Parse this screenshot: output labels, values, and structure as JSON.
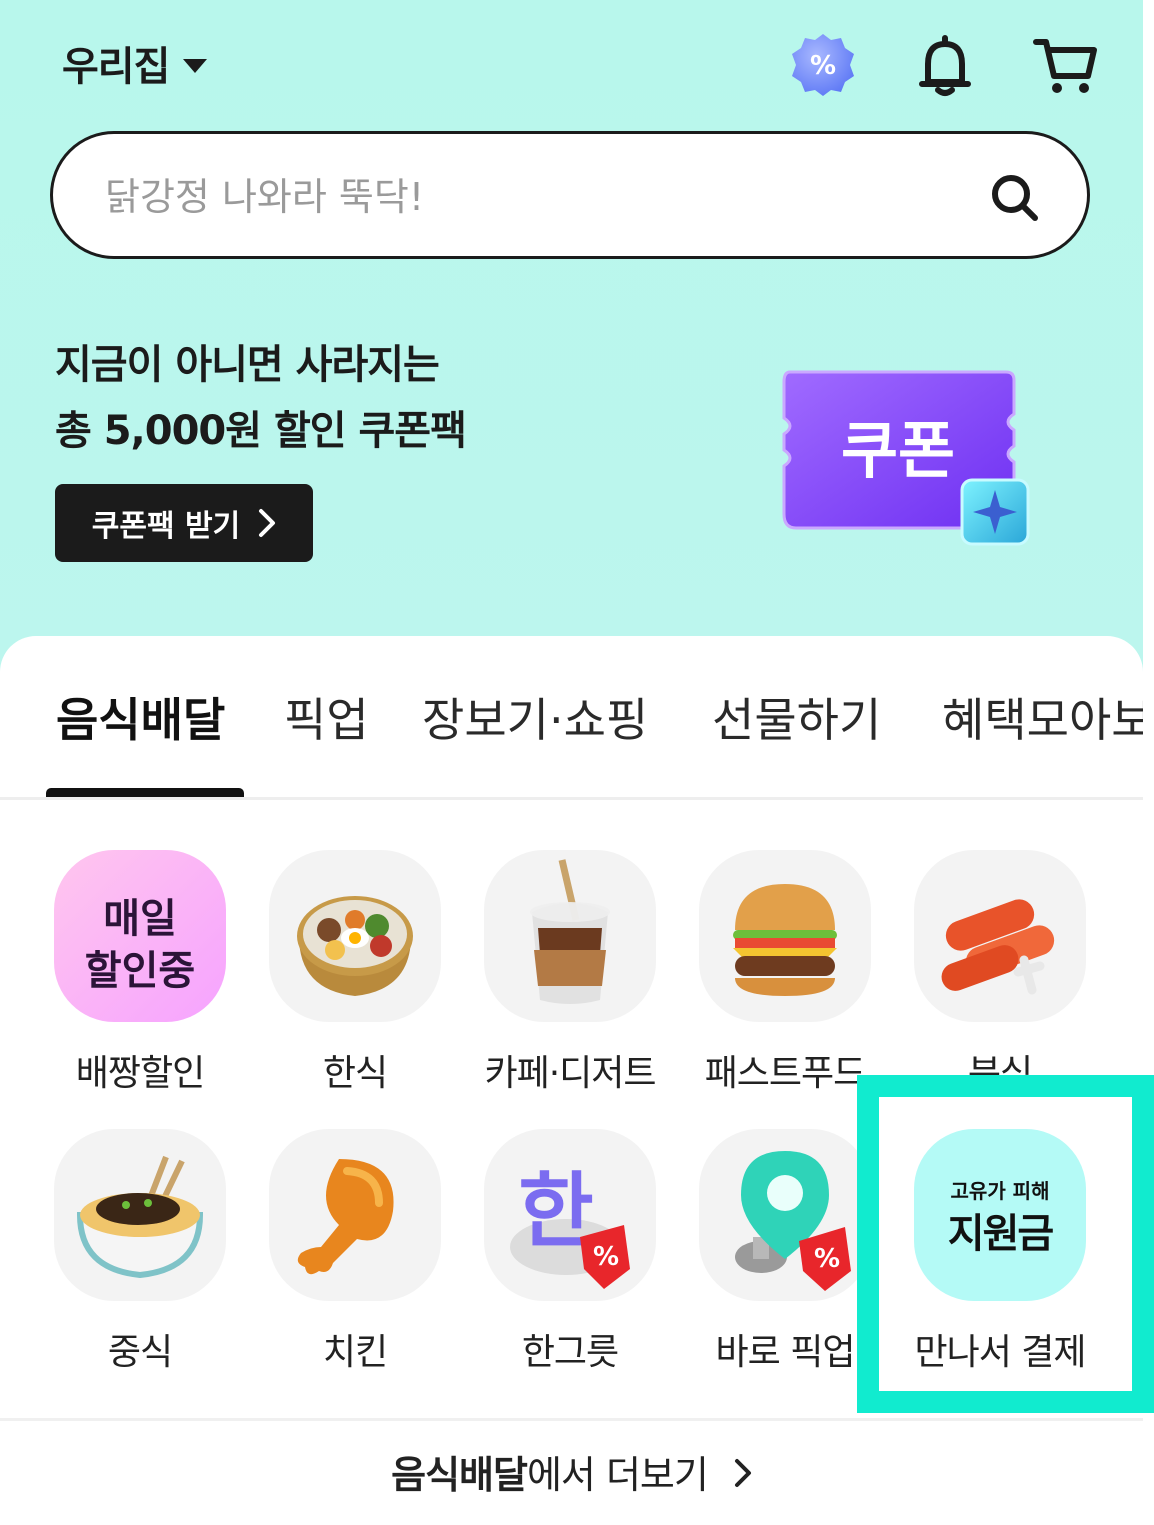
{
  "header": {
    "location": "우리집",
    "icons": [
      "discount-badge-icon",
      "bell-icon",
      "cart-icon"
    ],
    "discount_symbol": "%"
  },
  "search": {
    "placeholder": "닭강정 나와라 뚝닥!"
  },
  "promo": {
    "line1": "지금이 아니면 사라지는",
    "line2": "총 5,000원 할인 쿠폰팩",
    "button_label": "쿠폰팩 받기",
    "coupon_text": "쿠폰"
  },
  "tabs": [
    {
      "label": "음식배달",
      "active": true
    },
    {
      "label": "픽업"
    },
    {
      "label": "장보기·쇼핑"
    },
    {
      "label": "선물하기"
    },
    {
      "label": "혜택모아보기"
    }
  ],
  "categories": [
    {
      "label": "배짱할인",
      "icon": "daily-discount-icon",
      "tile_text": [
        "매일",
        "할인중"
      ]
    },
    {
      "label": "한식",
      "icon": "bibimbap-icon"
    },
    {
      "label": "카페·디저트",
      "icon": "iced-coffee-icon"
    },
    {
      "label": "패스트푸드",
      "icon": "burger-icon"
    },
    {
      "label": "분식",
      "icon": "tteokbokki-icon"
    },
    {
      "label": "중식",
      "icon": "jajangmyeon-icon"
    },
    {
      "label": "치킨",
      "icon": "chicken-leg-icon"
    },
    {
      "label": "한그릇",
      "icon": "han-bowl-icon",
      "tile_text": [
        "한"
      ],
      "badge": "%"
    },
    {
      "label": "바로 픽업",
      "icon": "pickup-pin-icon",
      "badge": "%"
    },
    {
      "label": "만나서 결제",
      "icon": "support-fund-icon",
      "tile_text": [
        "고유가 피해",
        "지원금"
      ]
    }
  ],
  "more": {
    "bold": "음식배달",
    "rest": "에서 더보기"
  },
  "colors": {
    "header_bg": "#b8f7ec",
    "highlight": "#11ebcf",
    "coupon_purple": "#8b4dff",
    "tile_bg": "#f3f3f3"
  }
}
